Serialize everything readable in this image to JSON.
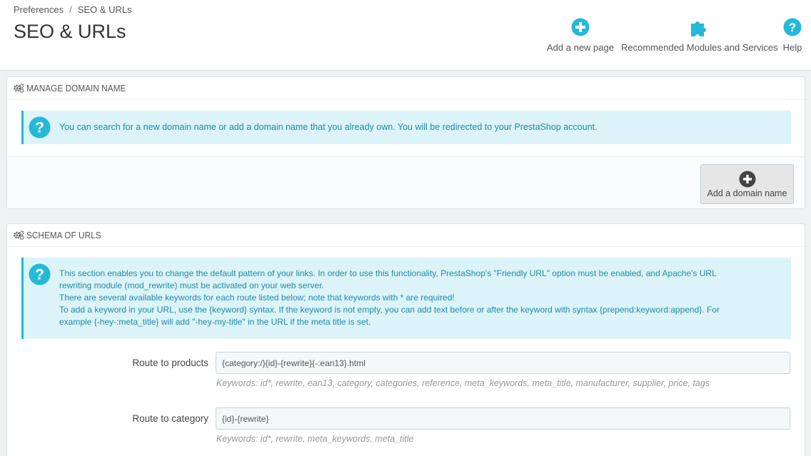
{
  "breadcrumb": {
    "parent": "Preferences",
    "separator": "/",
    "current": "SEO & URLs"
  },
  "page_title": "SEO & URLs",
  "toolbar": {
    "add_page": {
      "label": "Add a new page",
      "icon": "plus-circle-icon"
    },
    "modules": {
      "label": "Recommended Modules and Services",
      "icon": "puzzle-icon"
    },
    "help": {
      "label": "Help",
      "icon": "question-circle-icon"
    }
  },
  "domain_panel": {
    "title": "MANAGE DOMAIN NAME",
    "icon": "cogs-icon",
    "info": "You can search for a new domain name or add a domain name that you already own. You will be redirected to your PrestaShop account.",
    "button_label": "Add a domain name"
  },
  "schema_panel": {
    "title": "SCHEMA OF URLS",
    "icon": "cogs-icon",
    "info_lines": [
      "This section enables you to change the default pattern of your links. In order to use this functionality, PrestaShop's \"Friendly URL\" option must be enabled, and Apache's URL",
      "rewriting module (mod_rewrite) must be activated on your web server.",
      "There are several available keywords for each route listed below; note that keywords with * are required!",
      "To add a keyword in your URL, use the {keyword} syntax. If the keyword is not empty, you can add text before or after the keyword with syntax {prepend:keyword:append}. For",
      "example {-hey-:meta_title} will add \"-hey-my-title\" in the URL if the meta title is set."
    ],
    "routes": [
      {
        "label": "Route to products",
        "value": "{category:/}{id}-{rewrite}{-:ean13}.html",
        "help": "Keywords: id*, rewrite, ean13, category, categories, reference, meta_keywords, meta_title, manufacturer, supplier, price, tags"
      },
      {
        "label": "Route to category",
        "value": "{id}-{rewrite}",
        "help": "Keywords: id*, rewrite, meta_keywords, meta_title"
      }
    ]
  },
  "colors": {
    "accent": "#25b9d7",
    "info_bg": "#dcf4f9",
    "info_text": "#1e8ba3"
  }
}
